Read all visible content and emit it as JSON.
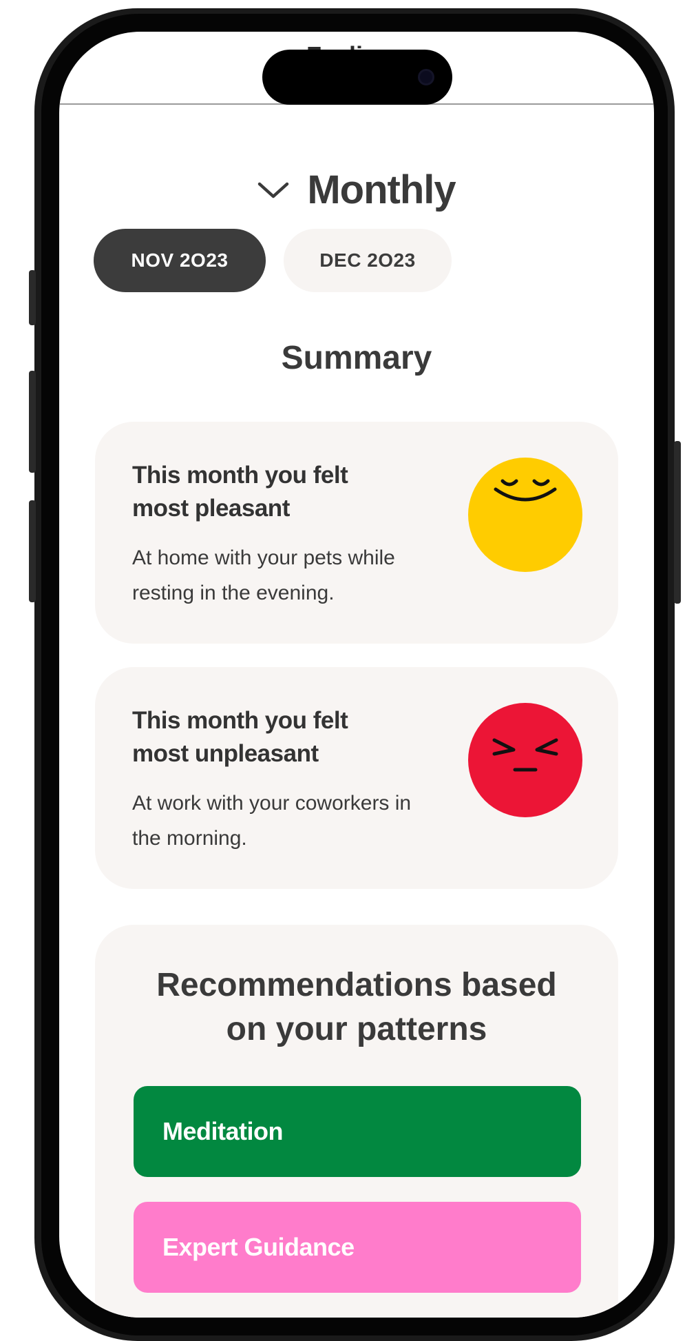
{
  "header": {
    "title": "Feelings",
    "period_label": "Monthly"
  },
  "month_tabs": [
    {
      "label": "NOV 2O23",
      "active": true
    },
    {
      "label": "DEC 2O23",
      "active": false
    }
  ],
  "summary": {
    "title": "Summary",
    "pleasant": {
      "heading": "This month you felt most pleasant",
      "body": "At home with your pets while resting in the evening.",
      "face_color": "#ffcc00"
    },
    "unpleasant": {
      "heading": "This month you felt most unpleasant",
      "body": "At work with your coworkers in the morning.",
      "face_color": "#ec1536"
    }
  },
  "recommendations": {
    "title": "Recommendations based on your patterns",
    "items": [
      {
        "label": "Meditation",
        "color": "#028840"
      },
      {
        "label": "Expert Guidance",
        "color": "#ff7ccb"
      }
    ]
  },
  "icons": {
    "period_toggle": "chevron-down-icon",
    "pleasant_face": "content-face-icon",
    "unpleasant_face": "frustrated-face-icon"
  }
}
